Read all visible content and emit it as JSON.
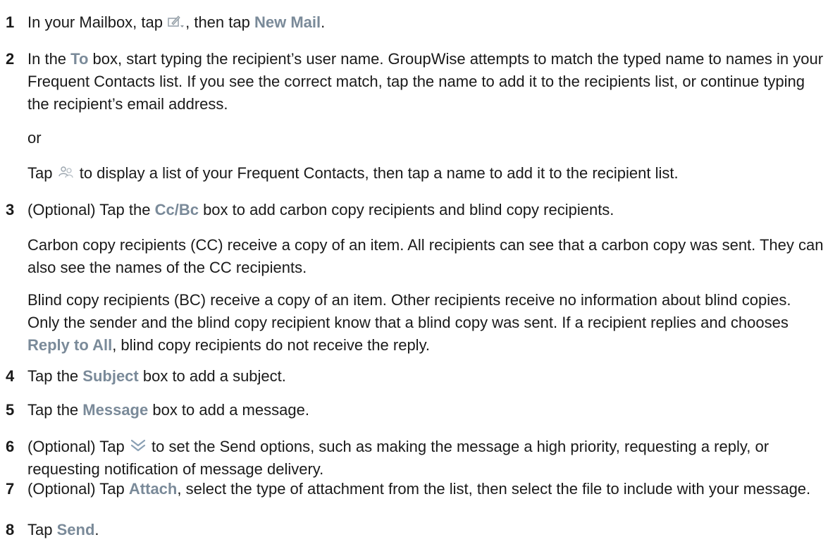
{
  "steps": [
    {
      "number": "1",
      "part1": "In your Mailbox, tap ",
      "icon": "compose-icon",
      "part2": ", then tap ",
      "ui_new_mail": "New Mail",
      "part3": "."
    },
    {
      "number": "2",
      "part1": "In the ",
      "ui_to": "To",
      "part2": " box, start typing the recipient’s user name. GroupWise attempts to match the typed name to names in your Frequent Contacts list. If you see the correct match, tap the name to add it to the recipients list, or continue typing the recipient’s email address.",
      "or_text": "or",
      "tap_text": "Tap ",
      "icon": "contacts-icon",
      "tap_rest": " to display a list of your Frequent Contacts, then tap a name to add it to the recipient list."
    },
    {
      "number": "3",
      "part1": "(Optional) Tap the ",
      "ui_ccbc": "Cc/Bc",
      "part2": " box to add carbon copy recipients and blind copy recipients.",
      "para_cc": "Carbon copy recipients (CC) receive a copy of an item. All recipients can see that a carbon copy was sent. They can also see the names of the CC recipients.",
      "para_bc1": "Blind copy recipients (BC) receive a copy of an item. Other recipients receive no information about blind copies. Only the sender and the blind copy recipient know that a blind copy was sent. If a recipient replies and chooses ",
      "ui_reply_all": "Reply to All",
      "para_bc2": ", blind copy recipients do not receive the reply."
    },
    {
      "number": "4",
      "part1": "Tap the ",
      "ui_subject": "Subject",
      "part2": " box to add a subject."
    },
    {
      "number": "5",
      "part1": "Tap the ",
      "ui_message": "Message",
      "part2": " box to add a message."
    },
    {
      "number": "6",
      "part1": "(Optional) Tap ",
      "icon": "double-chevron-down-icon",
      "part2": " to set the Send options, such as making the message a high priority, requesting a reply, or requesting notification of message delivery."
    },
    {
      "number": "7",
      "part1": "(Optional) Tap ",
      "ui_attach": "Attach",
      "part2": ", select the type of attachment from the list, then select the file to include with your message."
    },
    {
      "number": "8",
      "part1": "Tap ",
      "ui_send": "Send",
      "part2": "."
    }
  ],
  "colors": {
    "ui_term": "#7a8a99",
    "text": "#1a1a1a"
  }
}
